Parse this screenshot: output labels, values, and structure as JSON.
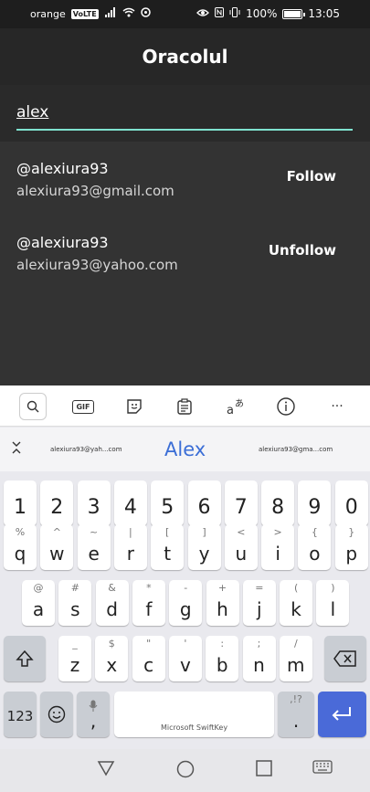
{
  "status_bar": {
    "carrier": "orange",
    "volte": "VoLTE",
    "battery": "100%",
    "time": "13:05"
  },
  "app": {
    "title": "Oracolul"
  },
  "search": {
    "value": "alex"
  },
  "results": [
    {
      "handle": "@alexiura93",
      "email": "alexiura93@gmail.com",
      "action": "Follow"
    },
    {
      "handle": "@alexiura93",
      "email": "alexiura93@yahoo.com",
      "action": "Unfollow"
    }
  ],
  "keyboard": {
    "toolbar": [
      "search-icon",
      "gif-icon",
      "sticker-icon",
      "clipboard-icon",
      "translate-icon",
      "info-icon",
      "more-icon"
    ],
    "gif_label": "GIF",
    "more_label": "···",
    "suggestions": {
      "left": "alexiura93@yah...com",
      "center": "Alex",
      "right": "alexiura93@gma...com"
    },
    "row_numbers": [
      "1",
      "2",
      "3",
      "4",
      "5",
      "6",
      "7",
      "8",
      "9",
      "0"
    ],
    "row1": [
      {
        "main": "q",
        "sec": "%"
      },
      {
        "main": "w",
        "sec": "^"
      },
      {
        "main": "e",
        "sec": "~"
      },
      {
        "main": "r",
        "sec": "|"
      },
      {
        "main": "t",
        "sec": "["
      },
      {
        "main": "y",
        "sec": "]"
      },
      {
        "main": "u",
        "sec": "<"
      },
      {
        "main": "i",
        "sec": ">"
      },
      {
        "main": "o",
        "sec": "{"
      },
      {
        "main": "p",
        "sec": "}"
      }
    ],
    "row2": [
      {
        "main": "a",
        "sec": "@"
      },
      {
        "main": "s",
        "sec": "#"
      },
      {
        "main": "d",
        "sec": "&"
      },
      {
        "main": "f",
        "sec": "*"
      },
      {
        "main": "g",
        "sec": "-"
      },
      {
        "main": "h",
        "sec": "+"
      },
      {
        "main": "j",
        "sec": "="
      },
      {
        "main": "k",
        "sec": "("
      },
      {
        "main": "l",
        "sec": ")"
      }
    ],
    "row3": [
      {
        "main": "z",
        "sec": "_"
      },
      {
        "main": "x",
        "sec": "$"
      },
      {
        "main": "c",
        "sec": "\""
      },
      {
        "main": "v",
        "sec": "'"
      },
      {
        "main": "b",
        "sec": ":"
      },
      {
        "main": "n",
        "sec": ";"
      },
      {
        "main": "m",
        "sec": "/"
      }
    ],
    "key_123": "123",
    "key_comma": ",",
    "key_period": ".",
    "key_period_sec": ",!?",
    "space_label": "Microsoft SwiftKey"
  },
  "colors": {
    "accent": "#7fe3d0",
    "enter_key": "#4a6ad8",
    "suggestion": "#3b6ed6"
  }
}
